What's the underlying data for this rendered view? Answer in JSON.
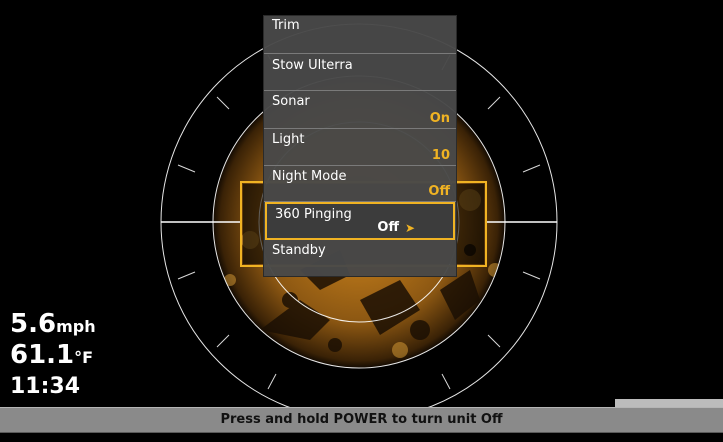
{
  "menu": {
    "items": [
      {
        "label": "Trim",
        "value": ""
      },
      {
        "label": "Stow Ulterra",
        "value": ""
      },
      {
        "label": "Sonar",
        "value": "On"
      },
      {
        "label": "Light",
        "value": "10"
      },
      {
        "label": "Night Mode",
        "value": "Off"
      },
      {
        "label": "360 Pinging",
        "value": "Off"
      },
      {
        "label": "Standby",
        "value": ""
      }
    ]
  },
  "readouts": {
    "speed_value": "5.6",
    "speed_unit": "mph",
    "temp_value": "61.1",
    "temp_unit": "°F",
    "time": "11:34"
  },
  "status": {
    "message": "Press and hold POWER to turn unit Off"
  },
  "colors": {
    "accent": "#f0b323",
    "sonar_gold": "#c8851f",
    "background": "#000000"
  },
  "icons": {
    "submenu_arrow": "chevron-right-icon"
  }
}
